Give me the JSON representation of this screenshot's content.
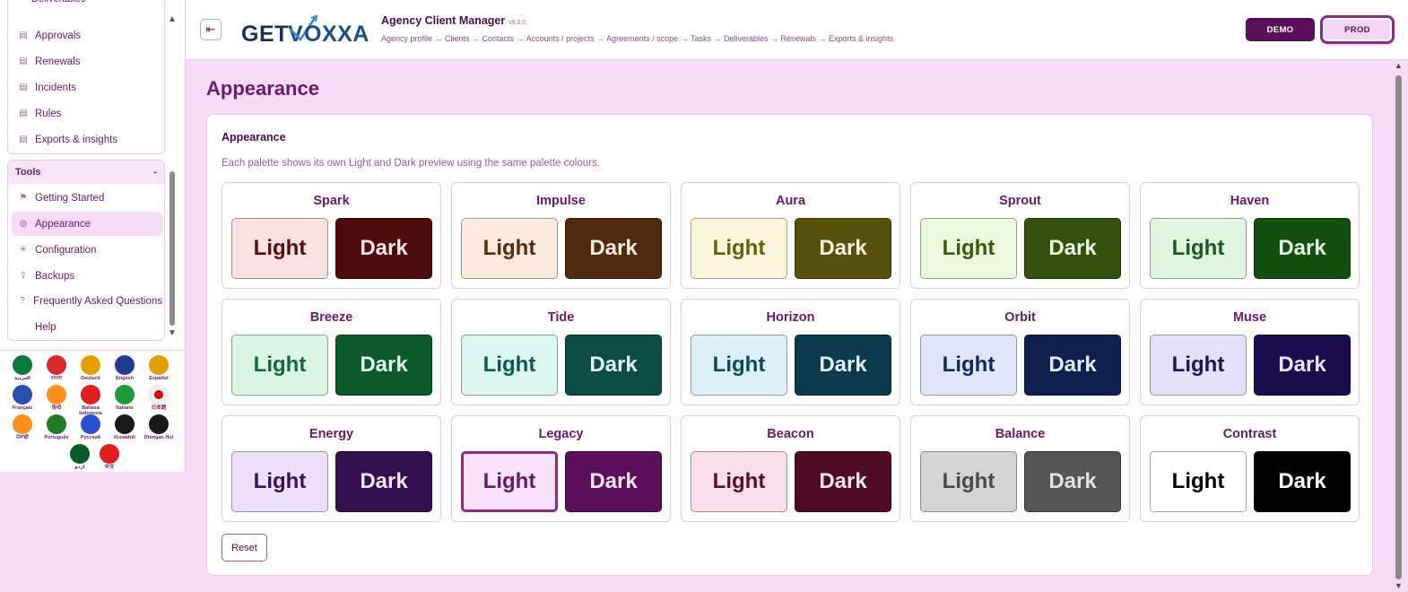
{
  "sidebar": {
    "items": [
      {
        "label": "Approvals"
      },
      {
        "label": "Renewals"
      },
      {
        "label": "Incidents"
      },
      {
        "label": "Rules"
      },
      {
        "label": "Exports & insights"
      }
    ],
    "tools_title": "Tools",
    "tools_toggle": "-",
    "tools": [
      {
        "label": "Getting Started",
        "icon": "flag-icon"
      },
      {
        "label": "Appearance",
        "icon": "palette-icon"
      },
      {
        "label": "Configuration",
        "icon": "gear-icon"
      },
      {
        "label": "Backups",
        "icon": "upload-icon"
      },
      {
        "label": "Frequently Asked Questions",
        "icon": "help-circle-icon"
      },
      {
        "label": "Help",
        "icon": ""
      }
    ],
    "languages": [
      {
        "label": "العربية",
        "color": "#0b7a3a"
      },
      {
        "label": "বাংলা",
        "color": "#d42a2a"
      },
      {
        "label": "Deutsch",
        "color": "#e0a000"
      },
      {
        "label": "English",
        "color": "#1f3a8a"
      },
      {
        "label": "Español",
        "color": "#e0a000"
      },
      {
        "label": "Français",
        "color": "#2a4fb0"
      },
      {
        "label": "हिन्दी",
        "color": "#ff8f1f"
      },
      {
        "label": "Bahasa Indonesia",
        "color": "#e01f1f"
      },
      {
        "label": "Italiano",
        "color": "#1f9a3a"
      },
      {
        "label": "日本語",
        "color": "#f0f0f0"
      },
      {
        "label": "ਪੰਜਾਬੀ",
        "color": "#ff8f1f"
      },
      {
        "label": "Português",
        "color": "#1f7a2a"
      },
      {
        "label": "Русский",
        "color": "#2a4fd0"
      },
      {
        "label": "Kiswahili",
        "color": "#1a1a1a"
      },
      {
        "label": "Dhingan Hol",
        "color": "#1a1a1a"
      },
      {
        "label": "اردو",
        "color": "#0b5a2a"
      },
      {
        "label": "中文",
        "color": "#e01f1f"
      }
    ]
  },
  "header": {
    "logo_text": "GETVOXXA",
    "app_title": "Agency Client Manager",
    "version": "v9.0.0",
    "breadcrumb": "Agency profile → Clients → Contacts → Accounts / projects → Agreements / scope → Tasks → Deliverables → Renewals → Exports & insights",
    "demo_label": "DEMO",
    "prod_label": "PROD"
  },
  "page": {
    "title": "Appearance",
    "card_title": "Appearance",
    "card_desc": "Each palette shows its own Light and Dark preview using the same palette colours.",
    "light_label": "Light",
    "dark_label": "Dark",
    "reset_label": "Reset"
  },
  "palettes": [
    {
      "name": "Spark",
      "light_bg": "#fbe1e1",
      "light_fg": "#5a0c0c",
      "dark_bg": "#4f0b0b",
      "dark_fg": "#f6e4e4"
    },
    {
      "name": "Impulse",
      "light_bg": "#fbeadd",
      "light_fg": "#5a2d0c",
      "dark_bg": "#502a0e",
      "dark_fg": "#f6ebe0"
    },
    {
      "name": "Aura",
      "light_bg": "#f9f6dc",
      "light_fg": "#6a5e10",
      "dark_bg": "#58510e",
      "dark_fg": "#f6f3dc"
    },
    {
      "name": "Sprout",
      "light_bg": "#ecf8dc",
      "light_fg": "#3a5a10",
      "dark_bg": "#33500e",
      "dark_fg": "#eef6e0"
    },
    {
      "name": "Haven",
      "light_bg": "#e0f6e0",
      "light_fg": "#1a5a1a",
      "dark_bg": "#13500f",
      "dark_fg": "#e4f6e4"
    },
    {
      "name": "Breeze",
      "light_bg": "#dcf6e6",
      "light_fg": "#106a3a",
      "dark_bg": "#0d5a2a",
      "dark_fg": "#e0f6e8"
    },
    {
      "name": "Tide",
      "light_bg": "#dcf7f0",
      "light_fg": "#0d5a4d",
      "dark_bg": "#0b4d44",
      "dark_fg": "#e0f6f1"
    },
    {
      "name": "Horizon",
      "light_bg": "#dcf0f7",
      "light_fg": "#0d4a5a",
      "dark_bg": "#0b3a4d",
      "dark_fg": "#e0f0f6"
    },
    {
      "name": "Orbit",
      "light_bg": "#e0e6f8",
      "light_fg": "#102a5a",
      "dark_bg": "#0e1f50",
      "dark_fg": "#e4e8f6"
    },
    {
      "name": "Muse",
      "light_bg": "#e4e0f8",
      "light_fg": "#1f145a",
      "dark_bg": "#1a0d4d",
      "dark_fg": "#e8e4f6"
    },
    {
      "name": "Energy",
      "light_bg": "#ece0f8",
      "light_fg": "#3a145a",
      "dark_bg": "#350e50",
      "dark_fg": "#ede4f6"
    },
    {
      "name": "Legacy",
      "light_bg": "#fae2fa",
      "light_fg": "#6b1a6b",
      "dark_bg": "#5a0f5a",
      "dark_fg": "#f6e4f6"
    },
    {
      "name": "Beacon",
      "light_bg": "#fadeea",
      "light_fg": "#5a102a",
      "dark_bg": "#4f0b24",
      "dark_fg": "#f6e4ec"
    },
    {
      "name": "Balance",
      "light_bg": "#d4d4d4",
      "light_fg": "#4a4a4a",
      "dark_bg": "#555555",
      "dark_fg": "#e0e0e0"
    },
    {
      "name": "Contrast",
      "light_bg": "#ffffff",
      "light_fg": "#000000",
      "dark_bg": "#000000",
      "dark_fg": "#ffffff"
    }
  ]
}
